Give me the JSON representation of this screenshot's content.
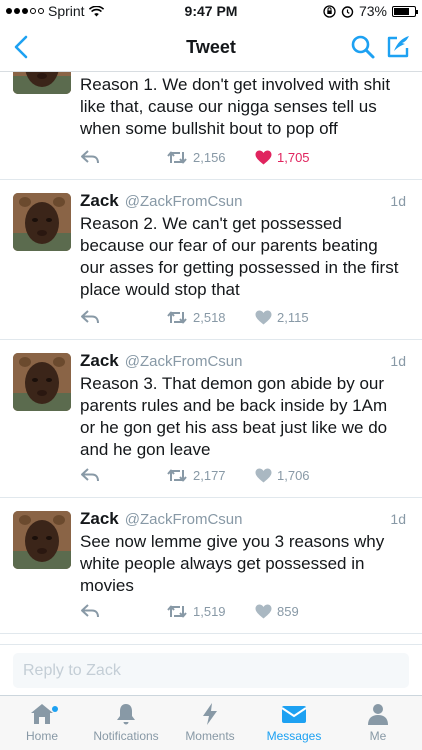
{
  "status_bar": {
    "carrier": "Sprint",
    "time": "9:47 PM",
    "battery": "73%",
    "battery_level": 0.73
  },
  "nav": {
    "title": "Tweet"
  },
  "tweets": [
    {
      "name": "",
      "handle": "",
      "time": "",
      "text": "Reason 1. We don't get involved with shit like that, cause our nigga senses tell us when some bullshit bout to pop off",
      "retweets": "2,156",
      "likes": "1,705",
      "liked": true
    },
    {
      "name": "Zack",
      "handle": "@ZackFromCsun",
      "time": "1d",
      "text": "Reason 2. We can't get possessed because our fear of our parents beating our asses for getting possessed in the first place would stop that",
      "retweets": "2,518",
      "likes": "2,115",
      "liked": false
    },
    {
      "name": "Zack",
      "handle": "@ZackFromCsun",
      "time": "1d",
      "text": "Reason 3. That demon gon abide by our parents rules and be back inside by 1Am or he gon get his ass beat just like we do and he gon leave",
      "retweets": "2,177",
      "likes": "1,706",
      "liked": false
    },
    {
      "name": "Zack",
      "handle": "@ZackFromCsun",
      "time": "1d",
      "text": "See now lemme give you 3 reasons why white people always get possessed in movies",
      "retweets": "1,519",
      "likes": "859",
      "liked": false
    }
  ],
  "reply": {
    "placeholder": "Reply to Zack"
  },
  "tabs": [
    {
      "label": "Home",
      "icon": "home-icon"
    },
    {
      "label": "Notifications",
      "icon": "bell-icon"
    },
    {
      "label": "Moments",
      "icon": "lightning-icon"
    },
    {
      "label": "Messages",
      "icon": "envelope-icon",
      "active": true
    },
    {
      "label": "Me",
      "icon": "person-icon"
    }
  ],
  "colors": {
    "accent": "#1da1f2",
    "like": "#e0245e",
    "muted": "#8899a6"
  }
}
